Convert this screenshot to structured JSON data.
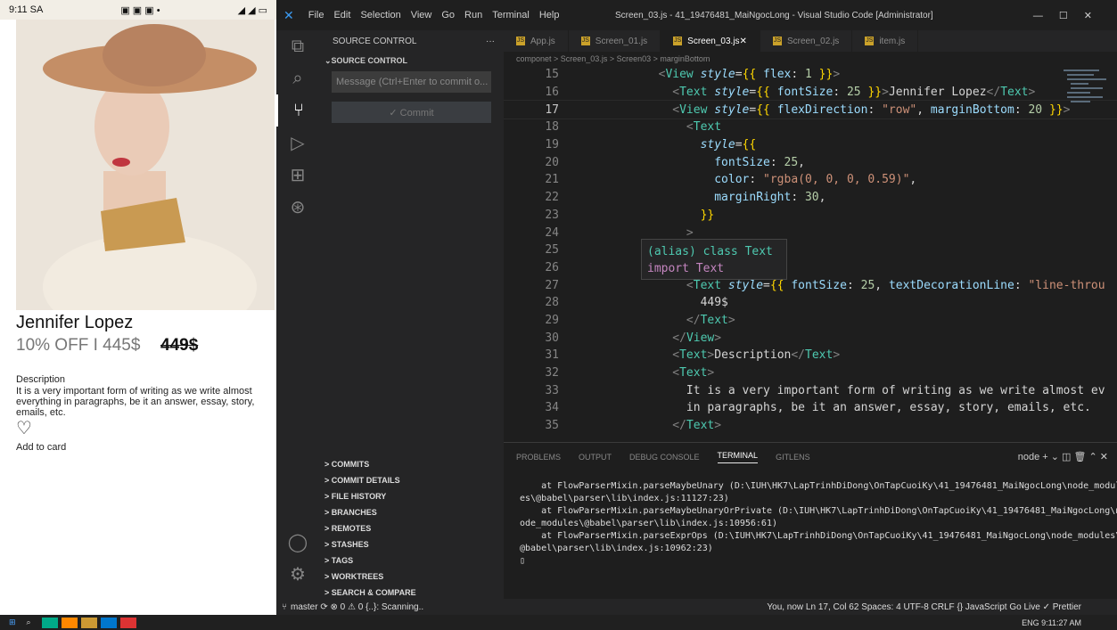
{
  "phone": {
    "status_time": "9:11 SA",
    "status_icons": "▣ ▣ ▣ •",
    "status_right": "◢ ◢ ▭",
    "product_name": "Jennifer Lopez",
    "discount": "10% OFF I 445$",
    "old_price": "449$",
    "desc_title": "Description",
    "desc_body": "It is a very important form of writing as we write almost everything in paragraphs, be it an answer, essay, story, emails, etc.",
    "add_to_card": "Add to card"
  },
  "vscode": {
    "menu": [
      "File",
      "Edit",
      "Selection",
      "View",
      "Go",
      "Run",
      "Terminal",
      "Help"
    ],
    "title": "Screen_03.js - 41_19476481_MaiNgocLong - Visual Studio Code [Administrator]",
    "sidebar_head": "SOURCE CONTROL",
    "sidebar_sub": "SOURCE CONTROL",
    "commit_placeholder": "Message (Ctrl+Enter to commit o...",
    "commit_label": "✓ Commit",
    "sections": [
      "COMMITS",
      "COMMIT DETAILS",
      "FILE HISTORY",
      "BRANCHES",
      "REMOTES",
      "STASHES",
      "TAGS",
      "WORKTREES",
      "SEARCH & COMPARE"
    ],
    "tabs": [
      {
        "label": "App.js",
        "active": false
      },
      {
        "label": "Screen_01.js",
        "active": false
      },
      {
        "label": "Screen_03.js",
        "active": true
      },
      {
        "label": "Screen_02.js",
        "active": false
      },
      {
        "label": "item.js",
        "active": false
      }
    ],
    "breadcrumb": "componet > Screen_03.js > Screen03 > marginBottom",
    "hover_line1": "(alias) class Text",
    "hover_line2": "import Text",
    "panel_tabs": [
      "PROBLEMS",
      "OUTPUT",
      "DEBUG CONSOLE",
      "TERMINAL",
      "GITLENS"
    ],
    "panel_active": "TERMINAL",
    "terminal_tools": "node + ⌄ ◫ 🗑 ⌃ ✕",
    "terminal": [
      "    at FlowParserMixin.parseMaybeUnary (D:\\IUH\\HK7\\LapTrinhDiDong\\OnTapCuoiKy\\41_19476481_MaiNgocLong\\node_modul",
      "es\\@babel\\parser\\lib\\index.js:11127:23)",
      "    at FlowParserMixin.parseMaybeUnaryOrPrivate (D:\\IUH\\HK7\\LapTrinhDiDong\\OnTapCuoiKy\\41_19476481_MaiNgocLong\\n",
      "ode_modules\\@babel\\parser\\lib\\index.js:10956:61)",
      "    at FlowParserMixin.parseExprOps (D:\\IUH\\HK7\\LapTrinhDiDong\\OnTapCuoiKy\\41_19476481_MaiNgocLong\\node_modules\\",
      "@babel\\parser\\lib\\index.js:10962:23)",
      "▯"
    ],
    "status_left": "master   ⟳   ⊗ 0 ⚠ 0   {..}: Scanning..",
    "status_right": "You, now   Ln 17, Col 62   Spaces: 4   UTF-8   CRLF   {} JavaScript   Go Live   ✓ Prettier",
    "taskbar_right": "ENG  9:11:27 AM"
  },
  "code": [
    {
      "n": "15",
      "h": "        <span class=\"p\">&lt;</span><span class=\"t\">View</span> <span class=\"a i\">style</span>=<span class=\"b\">{{</span> <span class=\"a\">flex</span>: <span class=\"n\">1</span> <span class=\"b\">}}</span><span class=\"p\">&gt;</span>"
    },
    {
      "n": "16",
      "h": "          <span class=\"p\">&lt;</span><span class=\"t\">Text</span> <span class=\"a i\">style</span>=<span class=\"b\">{{</span> <span class=\"a\">fontSize</span>: <span class=\"n\">25</span> <span class=\"b\">}}</span><span class=\"p\">&gt;</span>Jennifer Lopez<span class=\"p\">&lt;/</span><span class=\"t\">Text</span><span class=\"p\">&gt;</span>"
    },
    {
      "n": "17",
      "cur": true,
      "h": "          <span class=\"p\">&lt;</span><span class=\"t\">View</span> <span class=\"a i\">style</span>=<span class=\"b\">{{</span> <span class=\"a\">flexDirection</span>: <span class=\"s\">\"row\"</span>, <span class=\"a\">marginBottom</span>: <span class=\"n\">20</span> <span class=\"b\">}}</span><span class=\"p\">&gt;</span>"
    },
    {
      "n": "18",
      "h": "            <span class=\"p\">&lt;</span><span class=\"t\">Text</span>"
    },
    {
      "n": "19",
      "h": "              <span class=\"a i\">style</span>=<span class=\"b\">{{</span>"
    },
    {
      "n": "20",
      "h": "                <span class=\"a\">fontSize</span>: <span class=\"n\">25</span>,"
    },
    {
      "n": "21",
      "h": "                <span class=\"a\">color</span>: <span class=\"s\">\"rgba(0, 0, 0, 0.59)\"</span>,"
    },
    {
      "n": "22",
      "h": "                <span class=\"a\">marginRight</span>: <span class=\"n\">30</span>,"
    },
    {
      "n": "23",
      "h": "              <span class=\"b\">}}</span>"
    },
    {
      "n": "24",
      "h": "            <span class=\"p\">&gt;</span>"
    },
    {
      "n": "25",
      "h": ""
    },
    {
      "n": "26",
      "h": "            <span class=\"p\">&lt;</span>"
    },
    {
      "n": "27",
      "h": "            <span class=\"p\">&lt;</span><span class=\"t\">Text</span> <span class=\"a i\">style</span>=<span class=\"b\">{{</span> <span class=\"a\">fontSize</span>: <span class=\"n\">25</span>, <span class=\"a\">textDecorationLine</span>: <span class=\"s\">\"line-throu</span>"
    },
    {
      "n": "28",
      "h": "              449$"
    },
    {
      "n": "29",
      "h": "            <span class=\"p\">&lt;/</span><span class=\"t\">Text</span><span class=\"p\">&gt;</span>"
    },
    {
      "n": "30",
      "h": "          <span class=\"p\">&lt;/</span><span class=\"t\">View</span><span class=\"p\">&gt;</span>"
    },
    {
      "n": "31",
      "h": "          <span class=\"p\">&lt;</span><span class=\"t\">Text</span><span class=\"p\">&gt;</span>Description<span class=\"p\">&lt;/</span><span class=\"t\">Text</span><span class=\"p\">&gt;</span>"
    },
    {
      "n": "32",
      "h": "          <span class=\"p\">&lt;</span><span class=\"t\">Text</span><span class=\"p\">&gt;</span>"
    },
    {
      "n": "33",
      "h": "            It is a very important form of writing as we write almost ev"
    },
    {
      "n": "34",
      "h": "            in paragraphs, be it an answer, essay, story, emails, etc."
    },
    {
      "n": "35",
      "h": "          <span class=\"p\">&lt;/</span><span class=\"t\">Text</span><span class=\"p\">&gt;</span>"
    }
  ]
}
